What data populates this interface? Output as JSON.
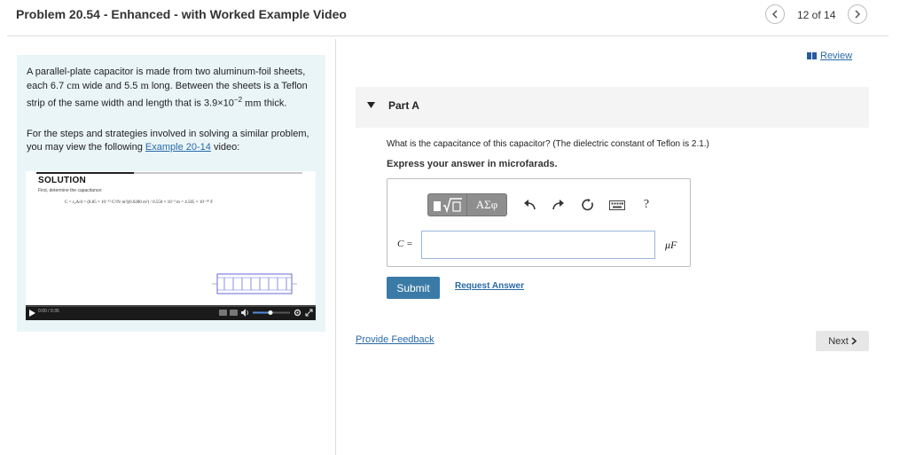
{
  "header": {
    "title": "Problem 20.54 - Enhanced - with Worked Example Video",
    "page_count": "12 of 14",
    "prev_icon": "chevron-left-icon",
    "next_icon": "chevron-right-icon"
  },
  "problem": {
    "p1_a": "A parallel-plate capacitor is made from two aluminum-foil sheets, each 6.7 ",
    "p1_unit_cm": "cm",
    "p1_b": " wide and 5.5 ",
    "p1_unit_m": "m",
    "p1_c": " long. Between the sheets is a Teflon strip of the same width and length that is 3.9×10",
    "p1_exp": "−2",
    "p1_unit_mm": " mm",
    "p1_d": " thick.",
    "p2_a": "For the steps and strategies involved in solving a similar problem, you may view the following ",
    "p2_link": "Example 20-14",
    "p2_b": " video:"
  },
  "video": {
    "solution_label": "SOLUTION",
    "caption": "First, determine the capacitance:",
    "formula": "C = ε₀A/d = (8.85 × 10⁻¹² C²/N·m²)(0.0280 m²) / 0.550 × 10⁻³ m = 4.505 × 10⁻¹⁰ F",
    "time": "0:00 / 0:35",
    "play_icon": "play-icon",
    "volume_icon": "volume-icon",
    "settings_icon": "gear-icon",
    "fullscreen_icon": "fullscreen-icon"
  },
  "right": {
    "review_icon": "book-icon",
    "review_label": "Review",
    "part_label": "Part A",
    "question": "What is the capacitance of this capacitor? (The dielectric constant of Teflon is 2.1.)",
    "instruction": "Express your answer in microfarads.",
    "toolbar": {
      "greek": "ΑΣφ",
      "undo_icon": "undo-icon",
      "redo_icon": "redo-icon",
      "reset_icon": "reset-icon",
      "keyboard_icon": "keyboard-icon",
      "help": "?"
    },
    "variable": "C =",
    "answer_value": "",
    "unit": "μF",
    "submit_label": "Submit",
    "request_answer_label": "Request Answer",
    "feedback_label": "Provide Feedback",
    "next_label": "Next"
  },
  "colors": {
    "accent": "#3a7aa6",
    "link": "#2a6aa8",
    "panel_bg": "#eaf5f8"
  }
}
